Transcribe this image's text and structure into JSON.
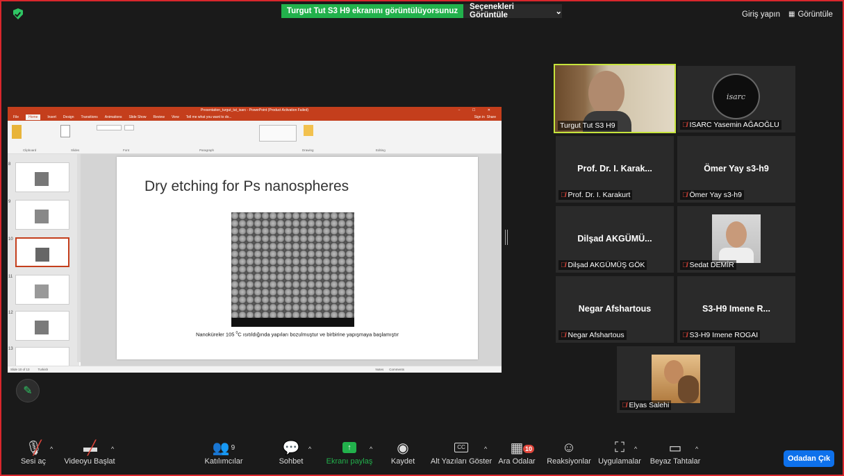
{
  "top": {
    "sharing_banner": "Turgut Tut S3 H9 ekranını görüntülüyorsunuz",
    "view_options": "Seçenekleri Görüntüle",
    "sign_in": "Giriş yapın",
    "view": "Görüntüle"
  },
  "ppt": {
    "title_bar": "Presentation_turgut_tut_isarc - PowerPoint (Product Activation Failed)",
    "sign_in": "Sign in",
    "share": "Share",
    "tabs": [
      "File",
      "Home",
      "Insert",
      "Design",
      "Transitions",
      "Animations",
      "Slide Show",
      "Review",
      "View",
      "Tell me what you want to do..."
    ],
    "ribbon_groups": [
      "Clipboard",
      "Slides",
      "Font",
      "Paragraph",
      "Drawing",
      "Editing"
    ],
    "slide_title": "Dry etching for Ps nanospheres",
    "caption_pre": "Nanoküreler 105 ",
    "caption_sup": "0",
    "caption_post": "C ısıtıldığında yapıları bozulmuştur ve birbirine yapışmaya başlamıştır",
    "status_left": "Slide 10 of 13",
    "status_lang": "Turkish",
    "status_notes": "Notes",
    "status_comments": "Comments",
    "thumb_numbers": [
      "8",
      "9",
      "10",
      "11",
      "12",
      "13"
    ]
  },
  "participants": [
    {
      "name": "Turgut Tut S3  H9",
      "big": ""
    },
    {
      "name": "ISARC Yasemin AĞAOĞLU",
      "big": ""
    },
    {
      "name": "Prof. Dr. I. Karakurt",
      "big": "Prof. Dr. I. Karak..."
    },
    {
      "name": "Ömer Yay s3-h9",
      "big": "Ömer Yay s3-h9"
    },
    {
      "name": "Dilşad AKGÜMÜŞ GÖK",
      "big": "Dilşad AKGÜMÜ..."
    },
    {
      "name": "Sedat DEMİR",
      "big": ""
    },
    {
      "name": "Negar Afshartous",
      "big": "Negar Afshartous"
    },
    {
      "name": "S3-H9 Imene ROGAI",
      "big": "S3-H9 Imene R..."
    },
    {
      "name": "Elyas Salehi",
      "big": ""
    }
  ],
  "isarc_logo_text": "isarc",
  "toolbar": {
    "audio": "Sesi aç",
    "video": "Videoyu Başlat",
    "participants": "Katılımcılar",
    "participants_count": "9",
    "chat": "Sohbet",
    "share": "Ekranı paylaş",
    "record": "Kaydet",
    "captions": "Alt Yazıları Göster",
    "breakout": "Ara Odalar",
    "breakout_count": "10",
    "reactions": "Reaksiyonlar",
    "apps": "Uygulamalar",
    "whiteboard": "Beyaz Tahtalar",
    "leave": "Odadan Çık"
  },
  "colors": {
    "accent_green": "#22b14c",
    "leave_blue": "#0e71eb",
    "frame_red": "#d9262c",
    "ppt_orange": "#c43e1c"
  }
}
